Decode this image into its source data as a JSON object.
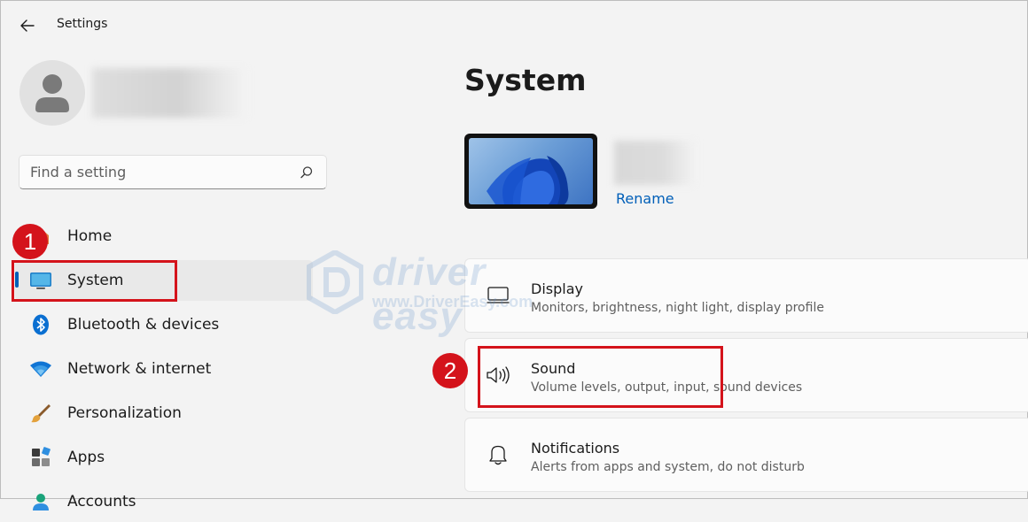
{
  "window": {
    "title": "Settings"
  },
  "search": {
    "placeholder": "Find a setting"
  },
  "sidebar": {
    "items": [
      {
        "id": "home",
        "label": "Home"
      },
      {
        "id": "system",
        "label": "System",
        "active": true
      },
      {
        "id": "bluetooth",
        "label": "Bluetooth & devices"
      },
      {
        "id": "network",
        "label": "Network & internet"
      },
      {
        "id": "personalization",
        "label": "Personalization"
      },
      {
        "id": "apps",
        "label": "Apps"
      },
      {
        "id": "accounts",
        "label": "Accounts"
      }
    ]
  },
  "main": {
    "title": "System",
    "device": {
      "rename_label": "Rename"
    },
    "cards": [
      {
        "id": "display",
        "icon": "display-icon",
        "title": "Display",
        "subtitle": "Monitors, brightness, night light, display profile"
      },
      {
        "id": "sound",
        "icon": "speaker-icon",
        "title": "Sound",
        "subtitle": "Volume levels, output, input, sound devices"
      },
      {
        "id": "notifications",
        "icon": "bell-icon",
        "title": "Notifications",
        "subtitle": "Alerts from apps and system, do not disturb"
      }
    ]
  },
  "annotations": {
    "step1": "1",
    "step2": "2"
  },
  "watermark": {
    "brand": "driver easy",
    "url": "www.DriverEasy.com"
  },
  "colors": {
    "accent": "#005fb8",
    "callout": "#d4131b",
    "background": "#f3f3f3",
    "card": "#fbfbfb"
  }
}
